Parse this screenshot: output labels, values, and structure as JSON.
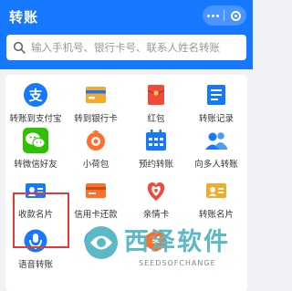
{
  "header": {
    "title": "转账",
    "bg": "#1677ff"
  },
  "search": {
    "placeholder": "输入手机号、银行卡号、联系人姓名转账"
  },
  "grid": [
    {
      "label": "转账到支付宝",
      "icon": "alipay-zhi-icon"
    },
    {
      "label": "转到银行卡",
      "icon": "bank-card-icon"
    },
    {
      "label": "红包",
      "icon": "red-packet-icon"
    },
    {
      "label": "转账记录",
      "icon": "transfer-records-icon"
    },
    {
      "label": "转微信好友",
      "icon": "wechat-icon"
    },
    {
      "label": "小荷包",
      "icon": "small-pouch-icon"
    },
    {
      "label": "预约转账",
      "icon": "calendar-icon"
    },
    {
      "label": "向多人转账",
      "icon": "multi-person-icon"
    },
    {
      "label": "收款名片",
      "icon": "receipt-card-icon"
    },
    {
      "label": "信用卡还款",
      "icon": "credit-card-icon"
    },
    {
      "label": "亲情卡",
      "icon": "family-card-icon"
    },
    {
      "label": "转账名片",
      "icon": "transfer-card-icon"
    },
    {
      "label": "语音转账",
      "icon": "voice-icon"
    },
    {
      "label": "",
      "icon": "gesture-icon"
    },
    {
      "label": "",
      "icon": "yen-icon"
    }
  ],
  "watermark": {
    "text": "西泽软件",
    "sub": "SEEDSOFCHANGE"
  }
}
